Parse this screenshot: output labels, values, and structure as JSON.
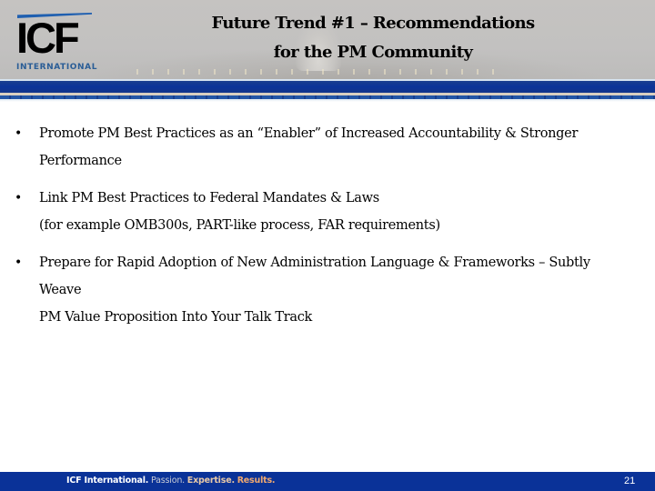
{
  "header": {
    "logo": {
      "letters": "ICF",
      "subtitle": "INTERNATIONAL"
    },
    "title_lines": [
      "Future Trend #1 – Recommendations",
      "for the PM Community"
    ],
    "background_image": "capitol-dome-at-dusk"
  },
  "bullets": [
    {
      "marker": "•",
      "lines": [
        "Promote PM Best Practices as an “Enabler” of Increased Accountability & Stronger",
        "Performance"
      ]
    },
    {
      "marker": "•",
      "lines": [
        "Link PM Best Practices to Federal Mandates & Laws",
        "(for example OMB300s, PART-like process, FAR requirements)"
      ]
    },
    {
      "marker": "•",
      "lines": [
        "Prepare for Rapid Adoption of New Administration Language & Frameworks – Subtly Weave",
        "PM Value Proposition Into Your Talk Track"
      ]
    }
  ],
  "footer": {
    "company": "ICF International.",
    "passion": "Passion.",
    "expertise": "Expertise.",
    "results": "Results.",
    "page_number": "21"
  },
  "colors": {
    "brand_blue": "#0a3298",
    "logo_swoosh": "#1f5fb0",
    "logo_text": "#2a5d96",
    "results_orange": "#f0a870",
    "expertise_tan": "#e8c9a8"
  }
}
